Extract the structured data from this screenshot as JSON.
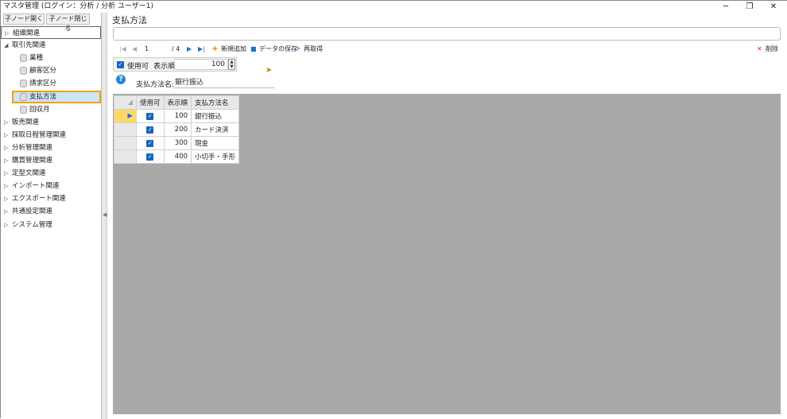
{
  "window": {
    "title": "マスタ管理 (ログイン：分析 / 分析 ユーザー1)",
    "min": "─",
    "restore": "❐",
    "close": "✕"
  },
  "tree": {
    "expand_button": "子ノード開く",
    "collapse_button": "子ノード閉じる",
    "nodes": [
      {
        "label": "組織関連",
        "arrow": "▷"
      },
      {
        "label": "取引先関連",
        "arrow": "◢"
      },
      {
        "label": "業種",
        "child": true
      },
      {
        "label": "顧客区分",
        "child": true
      },
      {
        "label": "請求区分",
        "child": true
      },
      {
        "label": "支払方法",
        "child": true,
        "selected": true
      },
      {
        "label": "回収月",
        "child": true
      },
      {
        "label": "販売関連",
        "arrow": "▷"
      },
      {
        "label": "採取日程管理関連",
        "arrow": "▷"
      },
      {
        "label": "分析管理関連",
        "arrow": "▷"
      },
      {
        "label": "購買管理関連",
        "arrow": "▷"
      },
      {
        "label": "定型文関連",
        "arrow": "▷"
      },
      {
        "label": "インポート関連",
        "arrow": "▷"
      },
      {
        "label": "エクスポート関連",
        "arrow": "▷"
      },
      {
        "label": "共通設定関連",
        "arrow": "▷"
      },
      {
        "label": "システム管理",
        "arrow": "▷"
      }
    ]
  },
  "main": {
    "heading": "支払方法",
    "toolbar": {
      "first": "|◀",
      "prev": "◀",
      "position": "1",
      "total": "/ 4",
      "next": "▶",
      "last": "▶|",
      "add": "新規追加",
      "save": "データの保存",
      "refresh": "再取得",
      "delete": "削除"
    },
    "filter": {
      "enabled_label": "使用可",
      "order_label": "表示順",
      "order_value": "100"
    },
    "name_label": "支払方法名:",
    "name_value": "銀行振込",
    "grid": {
      "columns": [
        "使用可",
        "表示順",
        "支払方法名"
      ],
      "rows": [
        {
          "order": "100",
          "name": "銀行振込"
        },
        {
          "order": "200",
          "name": "カード決済"
        },
        {
          "order": "300",
          "name": "現金"
        },
        {
          "order": "400",
          "name": "小切手・手形"
        }
      ]
    }
  }
}
